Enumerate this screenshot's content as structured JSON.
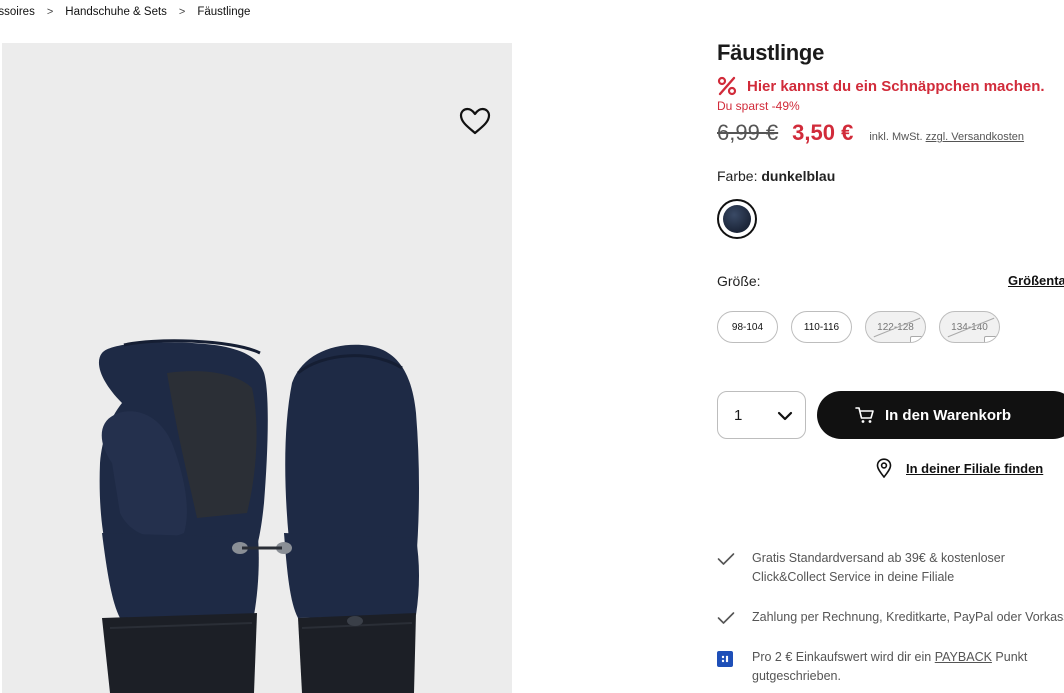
{
  "breadcrumb": {
    "items": [
      "essoires",
      "Handschuhe & Sets",
      "Fäustlinge"
    ]
  },
  "product": {
    "title": "Fäustlinge",
    "deal_text": "Hier kannst du ein Schnäppchen machen.",
    "savings": "Du sparst -49%",
    "old_price": "6,99 €",
    "new_price": "3,50 €",
    "tax_prefix": "inkl. MwSt.",
    "shipping_link": "zzgl. Versandkosten",
    "color_label": "Farbe:",
    "color_value": "dunkelblau",
    "swatch_color": "#1b2538",
    "size_label": "Größe:",
    "size_chart_link": "Größentabelle",
    "sizes": [
      {
        "label": "98-104",
        "available": true
      },
      {
        "label": "110-116",
        "available": true
      },
      {
        "label": "122-128",
        "available": false
      },
      {
        "label": "134-140",
        "available": false
      }
    ],
    "quantity": "1",
    "add_to_cart": "In den Warenkorb",
    "store_finder": "In deiner Filiale finden"
  },
  "usps": {
    "shipping_line1": "Gratis Standardversand ab 39€ & kostenloser",
    "shipping_line2": "Click&Collect Service in deine Filiale",
    "payment": "Zahlung per Rechnung, Kreditkarte, PayPal oder Vorkasse",
    "payback_prefix": "Pro 2 € Einkaufswert wird dir ein",
    "payback_link": "PAYBACK",
    "payback_suffix": "Punkt",
    "payback_line2": "gutgeschrieben."
  },
  "colors": {
    "accent_red": "#d12b3a",
    "button_black": "#111111",
    "image_bg": "#ececec",
    "payback_blue": "#1e4fb8"
  },
  "icons": [
    "heart-icon",
    "percent-icon",
    "chevron-down-icon",
    "cart-icon",
    "location-pin-icon",
    "check-icon",
    "payback-icon",
    "mail-icon"
  ]
}
